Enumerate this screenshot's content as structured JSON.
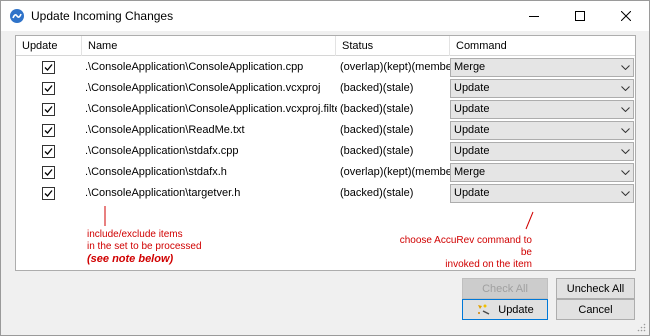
{
  "window": {
    "title": "Update Incoming Changes"
  },
  "table": {
    "headers": {
      "update": "Update",
      "name": "Name",
      "status": "Status",
      "command": "Command"
    },
    "rows": [
      {
        "checked": true,
        "name": ".\\ConsoleApplication\\ConsoleApplication.cpp",
        "status": "(overlap)(kept)(member)",
        "command": "Merge"
      },
      {
        "checked": true,
        "name": ".\\ConsoleApplication\\ConsoleApplication.vcxproj",
        "status": "(backed)(stale)",
        "command": "Update"
      },
      {
        "checked": true,
        "name": ".\\ConsoleApplication\\ConsoleApplication.vcxproj.filters",
        "status": "(backed)(stale)",
        "command": "Update"
      },
      {
        "checked": true,
        "name": ".\\ConsoleApplication\\ReadMe.txt",
        "status": "(backed)(stale)",
        "command": "Update"
      },
      {
        "checked": true,
        "name": ".\\ConsoleApplication\\stdafx.cpp",
        "status": "(backed)(stale)",
        "command": "Update"
      },
      {
        "checked": true,
        "name": ".\\ConsoleApplication\\stdafx.h",
        "status": "(overlap)(kept)(member)",
        "command": "Merge"
      },
      {
        "checked": true,
        "name": ".\\ConsoleApplication\\targetver.h",
        "status": "(backed)(stale)",
        "command": "Update"
      }
    ]
  },
  "annotations": {
    "left_line1": "include/exclude items",
    "left_line2": "in the set to be processed",
    "left_note": "(see note below)",
    "right_line1": "choose AccuRev command to be",
    "right_line2": "invoked on the item",
    "color": "#d00000"
  },
  "buttons": {
    "check_all": "Check All",
    "uncheck_all": "Uncheck All",
    "update": "Update",
    "cancel": "Cancel"
  },
  "icons": {
    "app": "accurev-logo-icon",
    "update": "update-sparkle-icon"
  }
}
